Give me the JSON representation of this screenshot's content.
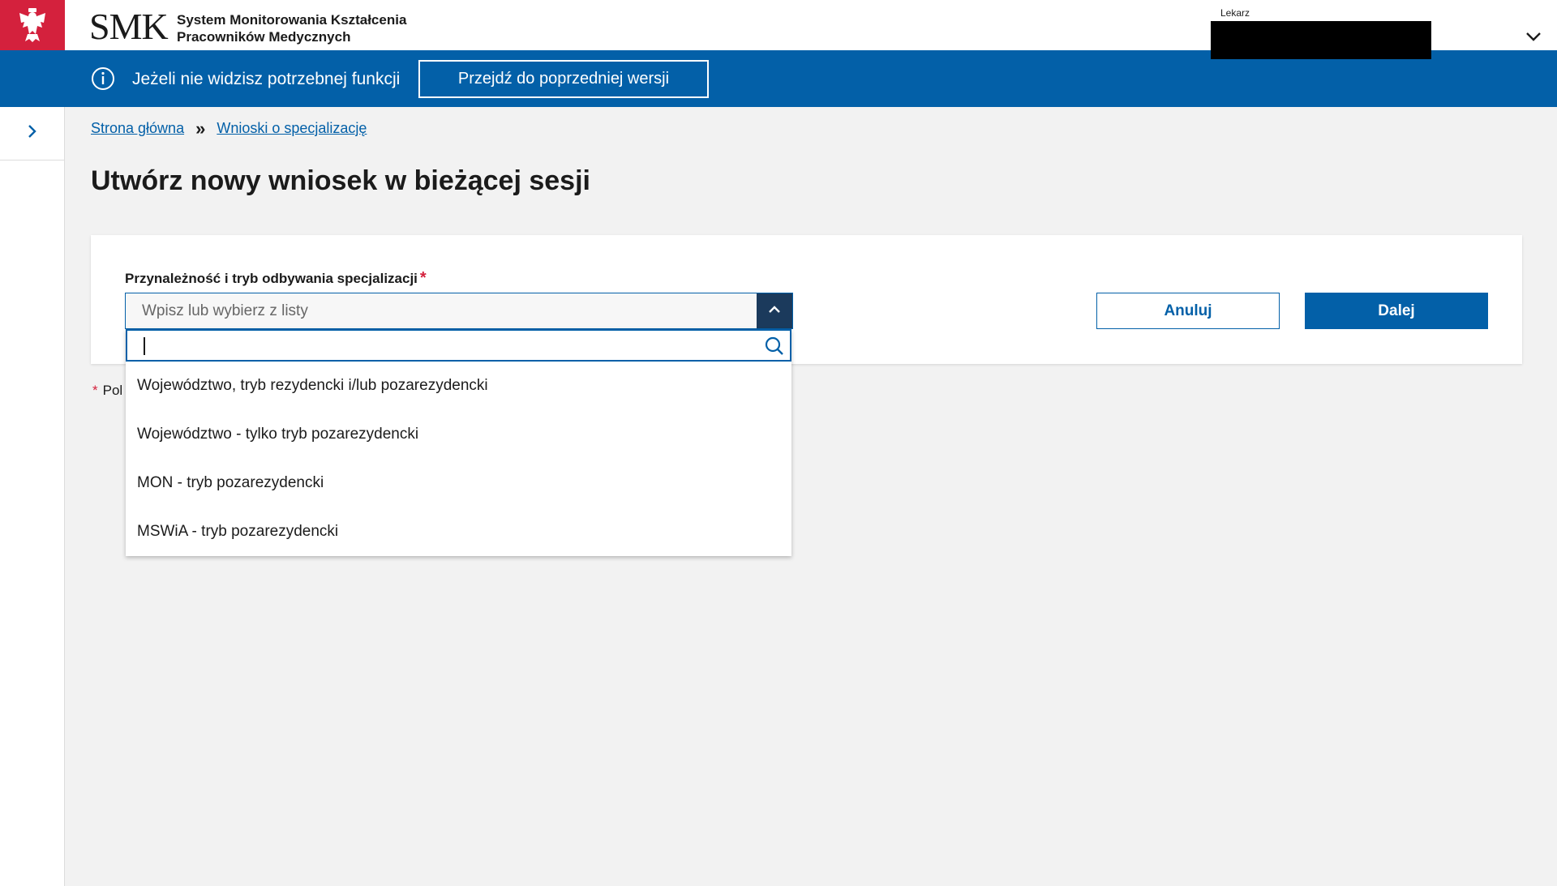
{
  "header": {
    "logo": "SMK",
    "system_name_line1": "System Monitorowania Kształcenia",
    "system_name_line2": "Pracowników Medycznych",
    "user_role": "Lekarz"
  },
  "infobar": {
    "message": "Jeżeli nie widzisz potrzebnej funkcji",
    "prev_version_label": "Przejdź do poprzedniej wersji"
  },
  "breadcrumb": {
    "items": [
      "Strona główna",
      "Wnioski o specjalizację"
    ],
    "separator": "»"
  },
  "page": {
    "title": "Utwórz nowy wniosek w bieżącej sesji"
  },
  "form": {
    "field_label": "Przynależność i tryb odbywania specjalizacji",
    "required_mark": "*",
    "combo_placeholder": "Wpisz lub wybierz z listy",
    "search_value": "",
    "cancel_label": "Anuluj",
    "next_label": "Dalej",
    "required_note_mark": "*",
    "required_note_visible": "Pol"
  },
  "dropdown": {
    "options": [
      "Województwo, tryb rezydencki i/lub pozarezydencki",
      "Województwo - tylko tryb pozarezydencki",
      "MON - tryb pozarezydencki",
      "MSWiA - tryb pozarezydencki"
    ]
  },
  "colors": {
    "brand_blue": "#0360a8",
    "emblem_red": "#d4213d",
    "dropdown_toggle": "#1b3a5c",
    "page_bg": "#f2f2f2"
  },
  "icons": {
    "emblem": "eagle-emblem-icon",
    "user_menu": "chevron-down-icon",
    "info": "info-icon",
    "sidebar": "chevron-right-icon",
    "combo_toggle": "chevron-up-icon",
    "search": "search-icon"
  }
}
